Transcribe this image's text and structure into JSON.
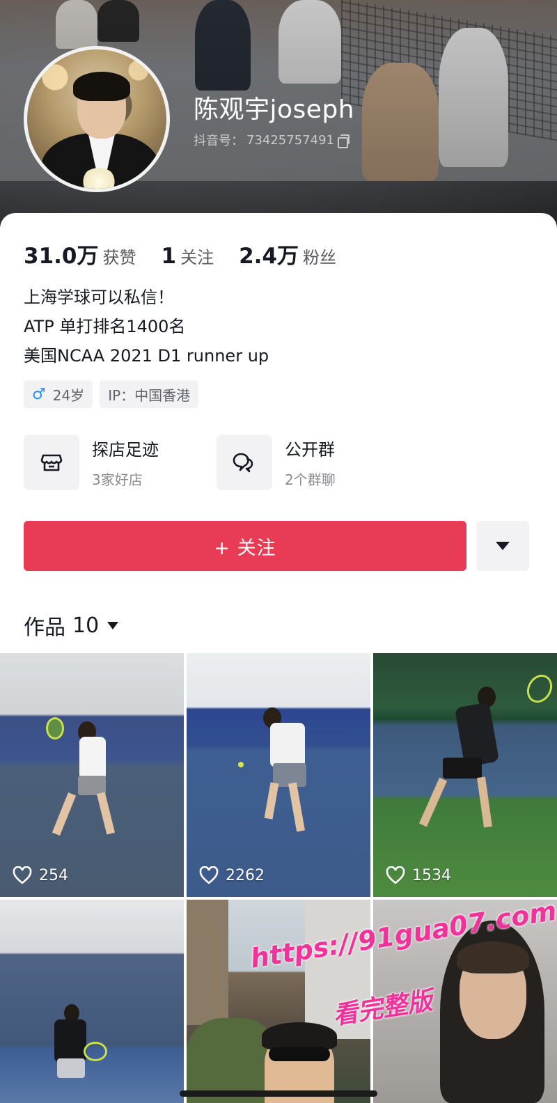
{
  "profile": {
    "username": "陈观宇joseph",
    "douyin_id_label": "抖音号：",
    "douyin_id": "73425757491"
  },
  "stats": [
    {
      "value": "31.0万",
      "label": "获赞"
    },
    {
      "value": "1",
      "label": "关注"
    },
    {
      "value": "2.4万",
      "label": "粉丝"
    }
  ],
  "bio": [
    "上海学球可以私信！",
    "ATP 单打排名1400名",
    "美国NCAA 2021 D1 runner up"
  ],
  "tags": {
    "age": "24岁",
    "ip": "IP：中国香港"
  },
  "features": [
    {
      "title": "探店足迹",
      "subtitle": "3家好店",
      "icon": "shop-icon"
    },
    {
      "title": "公开群",
      "subtitle": "2个群聊",
      "icon": "chat-icon"
    }
  ],
  "actions": {
    "follow_label": "+ 关注"
  },
  "works": {
    "label": "作品",
    "count": "10"
  },
  "videos": [
    {
      "likes": "254"
    },
    {
      "likes": "2262"
    },
    {
      "likes": "1534"
    },
    {
      "likes": ""
    },
    {
      "likes": ""
    },
    {
      "likes": ""
    }
  ],
  "watermark": {
    "line1": "https://91gua07.com",
    "line2": "看完整版",
    "color": "#f0329a"
  },
  "colors": {
    "follow_button": "#e83b55",
    "gender_icon": "#2c8ef0"
  }
}
